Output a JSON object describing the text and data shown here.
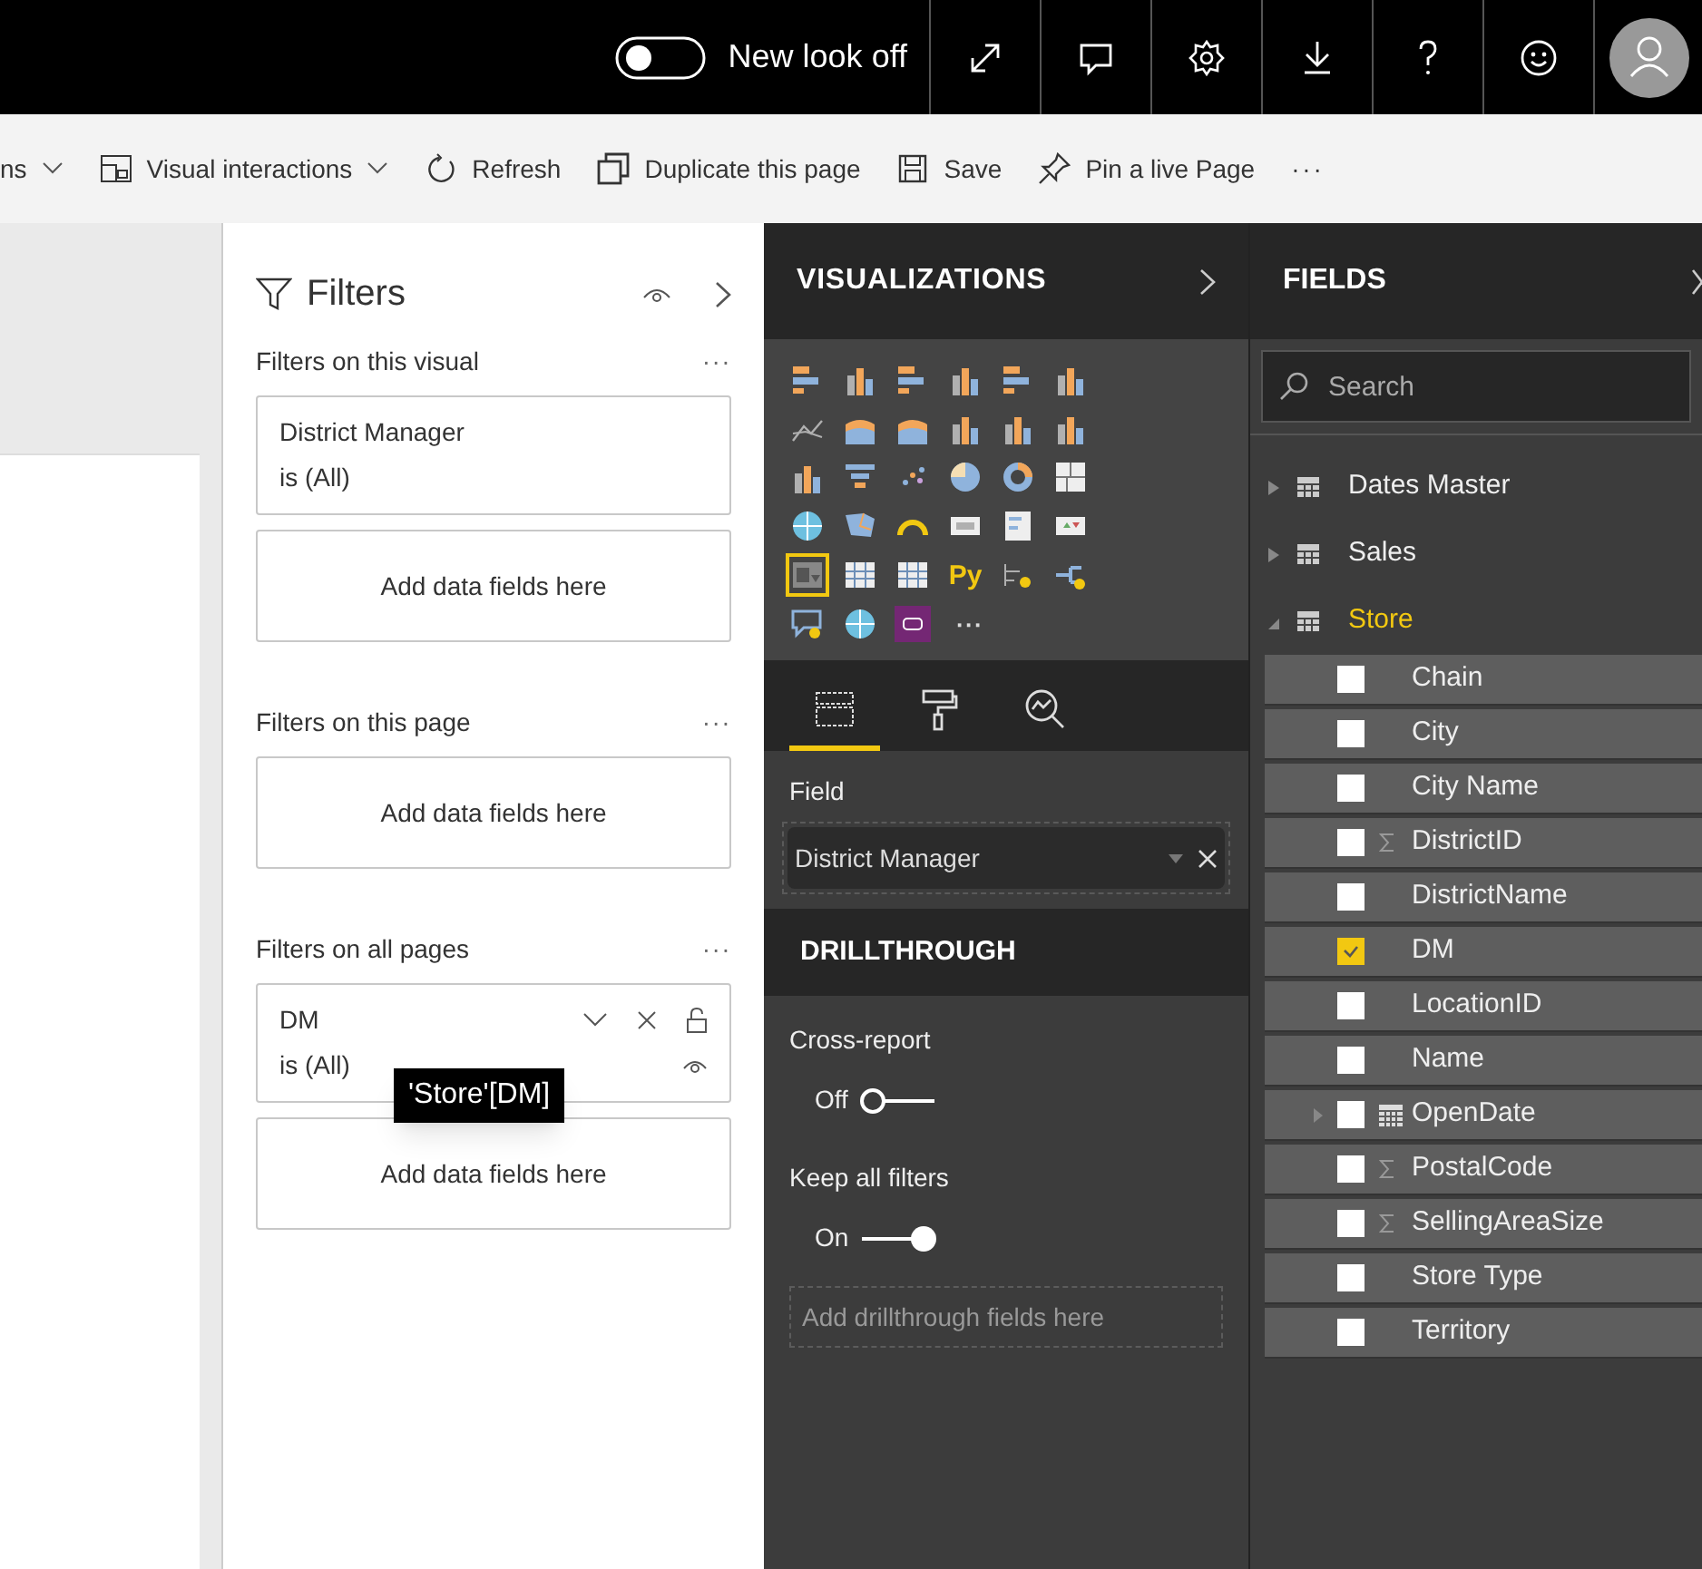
{
  "top_bar": {
    "new_look": {
      "label": "New look off",
      "on": false
    }
  },
  "toolbar": {
    "items": [
      {
        "kind": "dropdown-cut",
        "label": "ns"
      },
      {
        "kind": "interactions",
        "label": "Visual interactions"
      },
      {
        "kind": "refresh",
        "label": "Refresh"
      },
      {
        "kind": "duplicate",
        "label": "Duplicate this page"
      },
      {
        "kind": "save",
        "label": "Save"
      },
      {
        "kind": "pin",
        "label": "Pin a live Page"
      },
      {
        "kind": "more",
        "label": "···"
      }
    ]
  },
  "filters": {
    "title": "Filters",
    "sections": [
      {
        "title": "Filters on this visual",
        "more": "···",
        "cards": [
          {
            "field": "District Manager",
            "condition": "is (All)"
          }
        ],
        "drop": "Add data fields here"
      },
      {
        "title": "Filters on this page",
        "more": "···",
        "drop": "Add data fields here"
      },
      {
        "title": "Filters on all pages",
        "more": "···",
        "cards": [
          {
            "field": "DM",
            "condition": "is (All)",
            "tooltip": "'Store'[DM]"
          }
        ],
        "drop": "Add data fields here"
      }
    ]
  },
  "visualizations": {
    "title": "VISUALIZATIONS",
    "icons": [
      {
        "kind": "bar",
        "selected": false
      },
      {
        "kind": "column",
        "selected": false
      },
      {
        "kind": "bar",
        "selected": false
      },
      {
        "kind": "column",
        "selected": false
      },
      {
        "kind": "bar",
        "selected": false
      },
      {
        "kind": "column",
        "selected": false
      },
      {
        "kind": "line",
        "selected": false
      },
      {
        "kind": "area",
        "selected": false
      },
      {
        "kind": "area",
        "selected": false
      },
      {
        "kind": "column",
        "selected": false
      },
      {
        "kind": "column",
        "selected": false
      },
      {
        "kind": "column",
        "selected": false
      },
      {
        "kind": "column",
        "selected": false
      },
      {
        "kind": "funnel",
        "selected": false
      },
      {
        "kind": "scatter",
        "selected": false
      },
      {
        "kind": "pie",
        "selected": false
      },
      {
        "kind": "donut",
        "selected": false
      },
      {
        "kind": "treemap",
        "selected": false
      },
      {
        "kind": "globe",
        "selected": false
      },
      {
        "kind": "map",
        "selected": false
      },
      {
        "kind": "gauge",
        "selected": false
      },
      {
        "kind": "card",
        "selected": false
      },
      {
        "kind": "list",
        "selected": false
      },
      {
        "kind": "kpi",
        "selected": false
      },
      {
        "kind": "slicer",
        "selected": true
      },
      {
        "kind": "table",
        "selected": false
      },
      {
        "kind": "table",
        "selected": false
      },
      {
        "kind": "python",
        "label": "Py",
        "selected": false
      },
      {
        "kind": "influencers",
        "selected": false
      },
      {
        "kind": "tree",
        "selected": false
      },
      {
        "kind": "qna",
        "selected": false
      },
      {
        "kind": "globe",
        "selected": false
      },
      {
        "kind": "powerapps",
        "selected": false
      },
      {
        "kind": "more",
        "label": "···",
        "selected": false
      }
    ],
    "tabs": [
      {
        "kind": "fields",
        "selected": true
      },
      {
        "kind": "format",
        "selected": false
      },
      {
        "kind": "analytics",
        "selected": false
      }
    ],
    "well_label": "Field",
    "well_value": "District Manager",
    "drillthrough": {
      "title": "DRILLTHROUGH",
      "toggles": [
        {
          "label": "Cross-report",
          "state": "Off",
          "on": false
        },
        {
          "label": "Keep all filters",
          "state": "On",
          "on": true
        }
      ],
      "drop": "Add drillthrough fields here"
    }
  },
  "fields": {
    "title": "FIELDS",
    "search": {
      "placeholder": "Search"
    },
    "tables": [
      {
        "name": "Dates Master",
        "expanded": false
      },
      {
        "name": "Sales",
        "expanded": false
      },
      {
        "name": "Store",
        "expanded": true,
        "children": [
          {
            "name": "Chain",
            "kind": "text",
            "checked": false
          },
          {
            "name": "City",
            "kind": "text",
            "checked": false
          },
          {
            "name": "City Name",
            "kind": "text",
            "checked": false
          },
          {
            "name": "DistrictID",
            "kind": "numeric",
            "checked": false
          },
          {
            "name": "DistrictName",
            "kind": "text",
            "checked": false
          },
          {
            "name": "DM",
            "kind": "text",
            "checked": true
          },
          {
            "name": "LocationID",
            "kind": "text",
            "checked": false
          },
          {
            "name": "Name",
            "kind": "text",
            "checked": false
          },
          {
            "name": "OpenDate",
            "kind": "date",
            "checked": false
          },
          {
            "name": "PostalCode",
            "kind": "numeric",
            "checked": false
          },
          {
            "name": "SellingAreaSize",
            "kind": "numeric",
            "checked": false
          },
          {
            "name": "Store Type",
            "kind": "text",
            "checked": false
          },
          {
            "name": "Territory",
            "kind": "text",
            "checked": false
          }
        ]
      }
    ]
  }
}
